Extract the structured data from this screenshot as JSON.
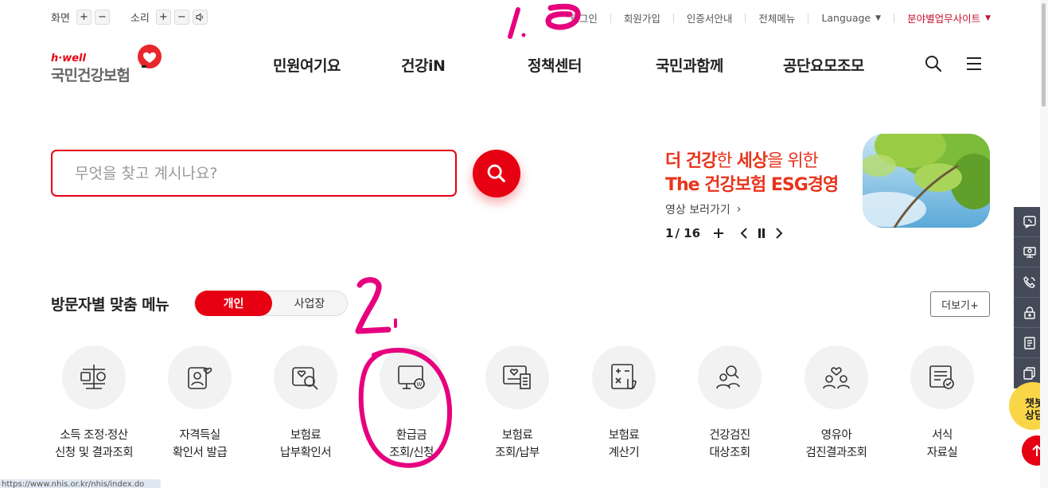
{
  "utility": {
    "screen_label": "화면",
    "sound_label": "소리",
    "plus": "+",
    "minus": "−",
    "links": [
      "로그인",
      "회원가입",
      "인증서안내",
      "전체메뉴"
    ],
    "language": "Language",
    "field_site": "분야별업무사이트"
  },
  "logo": {
    "sub": "h·well",
    "main": "국민건강보험"
  },
  "nav": [
    "민원여기요",
    "건강iN",
    "정책센터",
    "국민과함께",
    "공단요모조모"
  ],
  "search": {
    "placeholder": "무엇을 찾고 계시나요?"
  },
  "banner": {
    "line1_a": "더 건강",
    "line1_b": "한 ",
    "line1_c": "세상",
    "line1_d": "을 위한",
    "line2": "The 건강보험 ESG경영",
    "link": "영상 보러가기",
    "current": "1",
    "total": "/ 16"
  },
  "quick_menu": {
    "title": "방문자별 맞춤 메뉴",
    "tab_personal": "개인",
    "tab_business": "사업장",
    "more": "더보기+",
    "items": [
      {
        "line1": "소득 조정·정산",
        "line2": "신청 및 결과조회",
        "icon": "scale-icon"
      },
      {
        "line1": "자격득실",
        "line2": "확인서 발급",
        "icon": "person-heart-icon"
      },
      {
        "line1": "보험료",
        "line2": "납부확인서",
        "icon": "document-search-icon"
      },
      {
        "line1": "환급금",
        "line2": "조회/신청",
        "icon": "monitor-won-icon"
      },
      {
        "line1": "보험료",
        "line2": "조회/납부",
        "icon": "monitor-receipt-icon"
      },
      {
        "line1": "보험료",
        "line2": "계산기",
        "icon": "calculator-icon"
      },
      {
        "line1": "건강검진",
        "line2": "대상조회",
        "icon": "people-search-icon"
      },
      {
        "line1": "영유아",
        "line2": "검진결과조회",
        "icon": "family-heart-icon"
      },
      {
        "line1": "서식",
        "line2": "자료실",
        "icon": "form-check-icon"
      }
    ]
  },
  "chat": {
    "text": "챗봇\n상담"
  },
  "status_url": "https://www.nhis.or.kr/nhis/index.do",
  "annotations": {
    "one": "1.",
    "two": "2."
  },
  "colors": {
    "brand_red": "#e60012",
    "annotation": "#e6007e",
    "side_bar": "#454a59"
  }
}
